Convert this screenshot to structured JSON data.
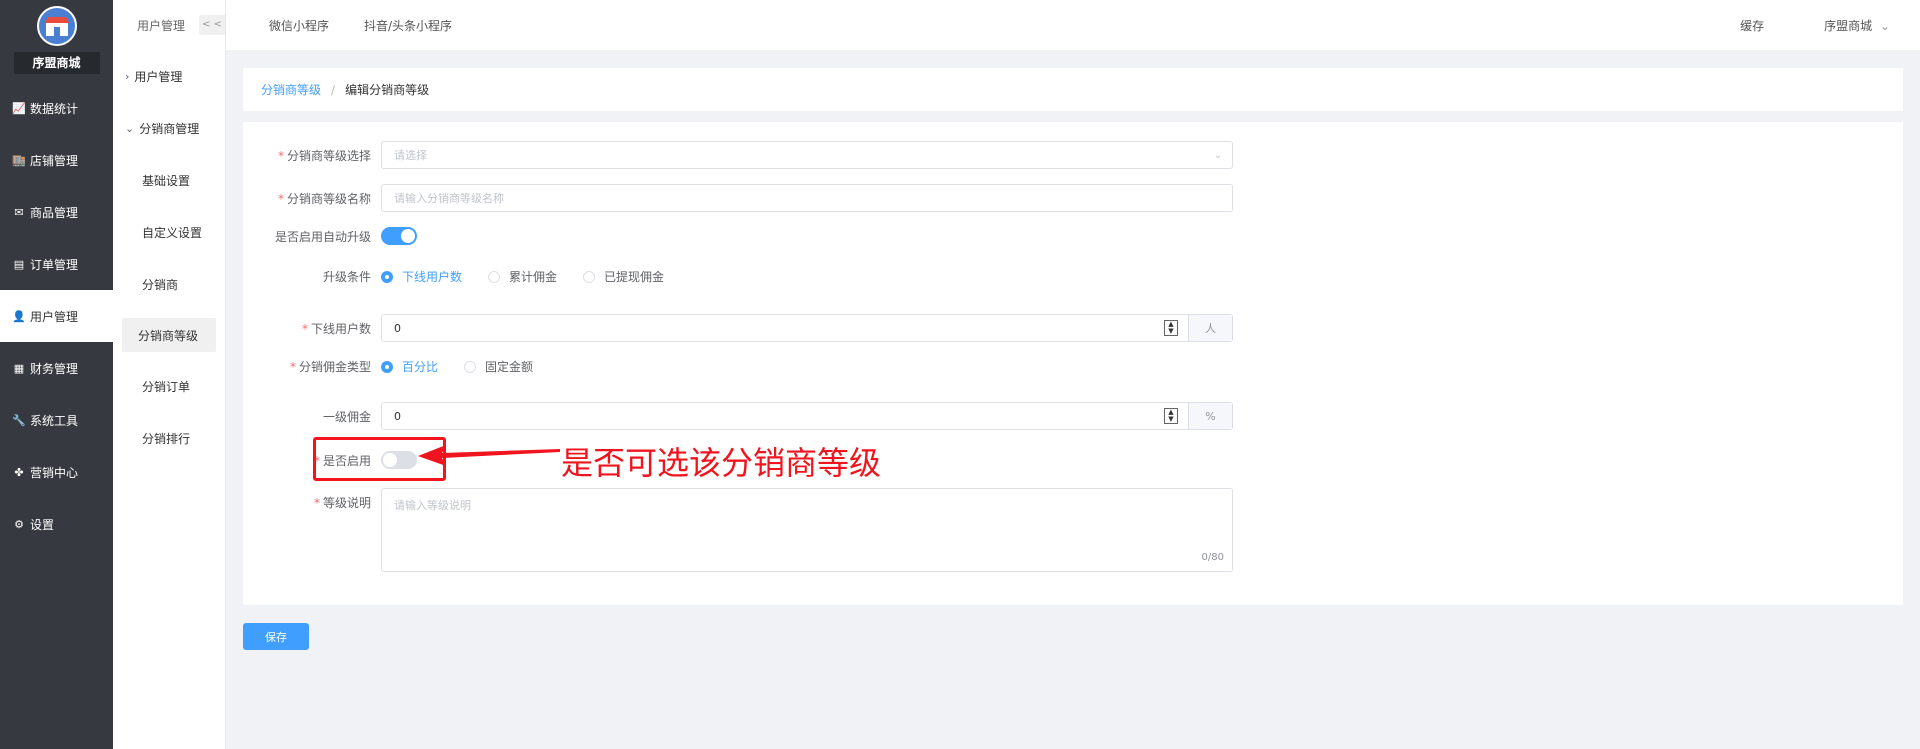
{
  "sidebar": {
    "shop_name": "序盟商城",
    "items": [
      {
        "label": "数据统计",
        "icon": "chart-icon"
      },
      {
        "label": "店铺管理",
        "icon": "store-icon"
      },
      {
        "label": "商品管理",
        "icon": "goods-icon"
      },
      {
        "label": "订单管理",
        "icon": "order-icon"
      },
      {
        "label": "用户管理",
        "icon": "user-icon"
      },
      {
        "label": "财务管理",
        "icon": "finance-icon"
      },
      {
        "label": "系统工具",
        "icon": "wrench-icon"
      },
      {
        "label": "营销中心",
        "icon": "marketing-icon"
      },
      {
        "label": "设置",
        "icon": "gear-icon"
      }
    ],
    "active": "用户管理"
  },
  "submenu": {
    "title": "用户管理",
    "collapse_label": "< <",
    "groups": [
      {
        "label": "用户管理"
      },
      {
        "label": "分销商管理"
      }
    ],
    "items": [
      "基础设置",
      "自定义设置",
      "分销商",
      "分销商等级",
      "分销订单",
      "分销排行"
    ],
    "active": "分销商等级"
  },
  "topbar": {
    "tabs": [
      "微信小程序",
      "抖音/头条小程序"
    ],
    "cache": "缓存",
    "user": "序盟商城"
  },
  "breadcrumb": {
    "parent": "分销商等级",
    "separator": "/",
    "current": "编辑分销商等级"
  },
  "form": {
    "level_select": {
      "label": "分销商等级选择",
      "placeholder": "请选择"
    },
    "level_name": {
      "label": "分销商等级名称",
      "placeholder": "请输入分销商等级名称"
    },
    "auto_upgrade": {
      "label": "是否启用自动升级",
      "on": true
    },
    "upgrade_condition": {
      "label": "升级条件",
      "options": [
        "下线用户数",
        "累计佣金",
        "已提现佣金"
      ],
      "selected": "下线用户数"
    },
    "downline_count": {
      "label": "下线用户数",
      "value": "0",
      "unit": "人"
    },
    "commission_type": {
      "label": "分销佣金类型",
      "options": [
        "百分比",
        "固定金额"
      ],
      "selected": "百分比"
    },
    "level1_commission": {
      "label": "一级佣金",
      "value": "0",
      "unit": "%"
    },
    "enabled": {
      "label": "是否启用",
      "on": false
    },
    "description": {
      "label": "等级说明",
      "placeholder": "请输入等级说明",
      "counter": "0/80"
    }
  },
  "annotation": "是否可选该分销商等级",
  "save_label": "保存"
}
